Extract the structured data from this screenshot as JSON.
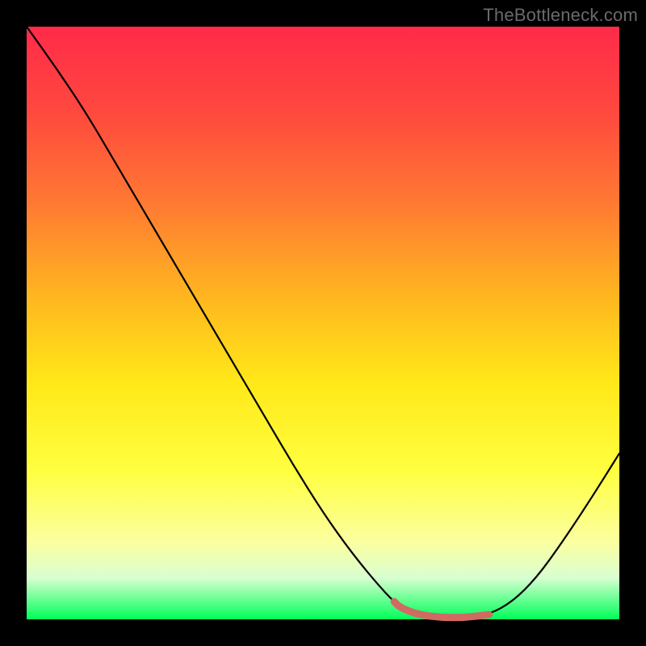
{
  "watermark": "TheBottleneck.com",
  "colors": {
    "frame_bg": "#000000",
    "curve": "#000000",
    "highlight": "#d16a63",
    "gradient_top": "#ff2a49",
    "gradient_bottom": "#00ff5a"
  },
  "chart_data": {
    "type": "line",
    "title": "",
    "xlabel": "",
    "ylabel": "",
    "xlim": [
      0,
      100
    ],
    "ylim": [
      0,
      100
    ],
    "grid": false,
    "legend": false,
    "series": [
      {
        "name": "bottleneck-curve",
        "x": [
          0,
          5,
          10,
          15,
          20,
          25,
          30,
          35,
          40,
          45,
          50,
          55,
          60,
          63,
          66,
          70,
          74,
          78,
          82,
          86,
          90,
          95,
          100
        ],
        "y": [
          100,
          93,
          85.5,
          77,
          68.5,
          60,
          51.5,
          43,
          34.5,
          26,
          18,
          11,
          5,
          2,
          0.8,
          0.3,
          0.3,
          0.8,
          3,
          7,
          12.5,
          20,
          28
        ],
        "color": "#000000",
        "highlight_range_x": [
          62,
          78
        ],
        "highlight_color": "#d16a63"
      }
    ]
  }
}
